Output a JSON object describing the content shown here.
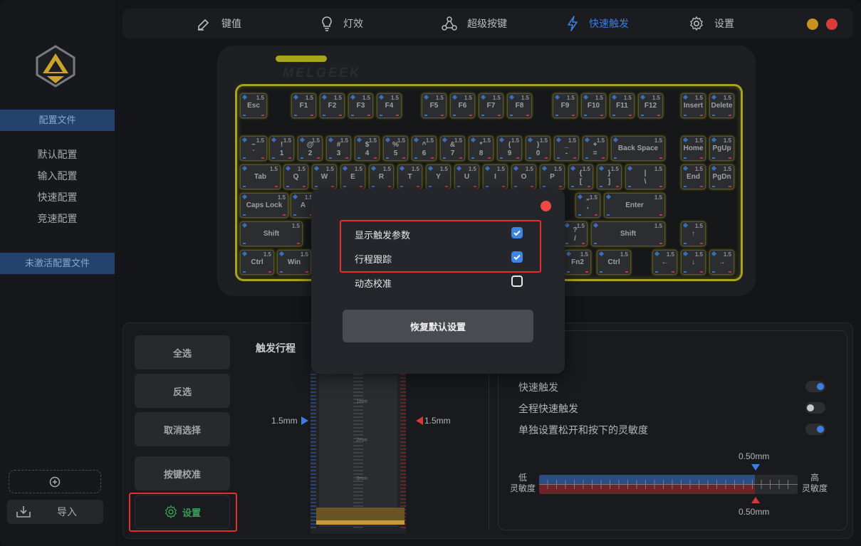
{
  "nav": {
    "tabs": [
      {
        "label": "键值",
        "icon": "pencil-icon"
      },
      {
        "label": "灯效",
        "icon": "bulb-icon"
      },
      {
        "label": "超级按键",
        "icon": "network-icon"
      },
      {
        "label": "快速触发",
        "icon": "lightning-icon",
        "active": true
      },
      {
        "label": "设置",
        "icon": "gear-icon"
      }
    ],
    "window_controls": {
      "minimize_color": "#c9911e",
      "close_color": "#d93b3b"
    }
  },
  "sidebar": {
    "header": "配置文件",
    "profiles": [
      "默认配置",
      "输入配置",
      "快速配置",
      "竞速配置"
    ],
    "inactive_header": "未激活配置文件",
    "add_icon": "plus-circle-icon",
    "import_label": "导入"
  },
  "keyboard": {
    "brand": "MELGEEK",
    "default_value": "1.5"
  },
  "actions": {
    "select_all": "全选",
    "invert": "反选",
    "deselect": "取消选择",
    "calibrate": "按键校准",
    "settings": "设置"
  },
  "travel": {
    "title": "触发行程",
    "press_value": "1.5mm",
    "release_value": "1.5mm",
    "scale": [
      "1mm",
      "2mm",
      "3mm",
      "4mm"
    ]
  },
  "rt_settings": {
    "items": [
      {
        "label": "快速触发",
        "on": true
      },
      {
        "label": "全程快速触发",
        "on": false
      },
      {
        "label": "单独设置松开和按下的灵敏度",
        "on": true
      }
    ],
    "low_label": "低\n灵敏度",
    "high_label": "高\n灵敏度",
    "press_sens": "0.50mm",
    "release_sens": "0.50mm"
  },
  "modal": {
    "options": [
      {
        "label": "显示触发参数",
        "checked": true
      },
      {
        "label": "行程跟踪",
        "checked": true
      },
      {
        "label": "动态校准",
        "checked": false
      }
    ],
    "reset_label": "恢复默认设置"
  },
  "colors": {
    "accent": "#3b7de0",
    "highlight": "#e53029",
    "keyglow": "#a8a21f"
  }
}
